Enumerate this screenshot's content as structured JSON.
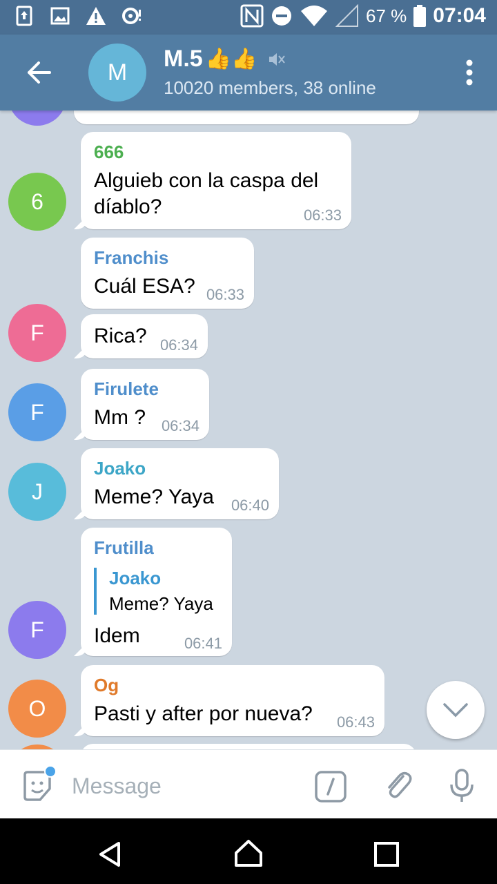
{
  "status_bar": {
    "battery": "67 %",
    "time": "07:04"
  },
  "header": {
    "avatar_letter": "M",
    "title": "M.5",
    "title_emoji": "👍👍",
    "subtitle": "10020 members, 38 online"
  },
  "messages": [
    {
      "avatar": "6",
      "sender": "666",
      "sender_color": "#4caf50",
      "avatar_color": "#78c84f",
      "text_line1": "Alguieb con la caspa del",
      "text_line2": "díablo?",
      "time": "06:33"
    },
    {
      "sender": "Franchis",
      "sender_color": "#4f8ecb",
      "text": "Cuál ESA?",
      "time": "06:33"
    },
    {
      "avatar": "F",
      "avatar_color": "#ee6c95",
      "text": "Rica?",
      "time": "06:34"
    },
    {
      "avatar": "F",
      "sender": "Firulete",
      "sender_color": "#4f8ecb",
      "avatar_color": "#5a9ee6",
      "text": "Mm ?",
      "time": "06:34"
    },
    {
      "avatar": "J",
      "sender": "Joako",
      "sender_color": "#3da6c7",
      "avatar_color": "#58bcda",
      "text": "Meme? Yaya",
      "time": "06:40"
    },
    {
      "avatar": "F",
      "sender": "Frutilla",
      "sender_color": "#4f8ecb",
      "avatar_color": "#8c7bed",
      "reply_name": "Joako",
      "reply_text": "Meme? Yaya",
      "text": "Idem",
      "time": "06:41"
    },
    {
      "avatar": "O",
      "sender": "Og",
      "sender_color": "#e07a2a",
      "avatar_color": "#f28c48",
      "text": "Pasti y after por nueva?",
      "time": "06:43"
    }
  ],
  "input": {
    "placeholder": "Message"
  },
  "icons": {
    "back": "back-arrow-icon",
    "menu": "more-vert-icon",
    "mute": "muted-speaker-icon",
    "sticker": "sticker-icon",
    "command": "bot-command-icon",
    "attach": "paperclip-icon",
    "mic": "microphone-icon",
    "scroll": "chevron-down-icon"
  }
}
